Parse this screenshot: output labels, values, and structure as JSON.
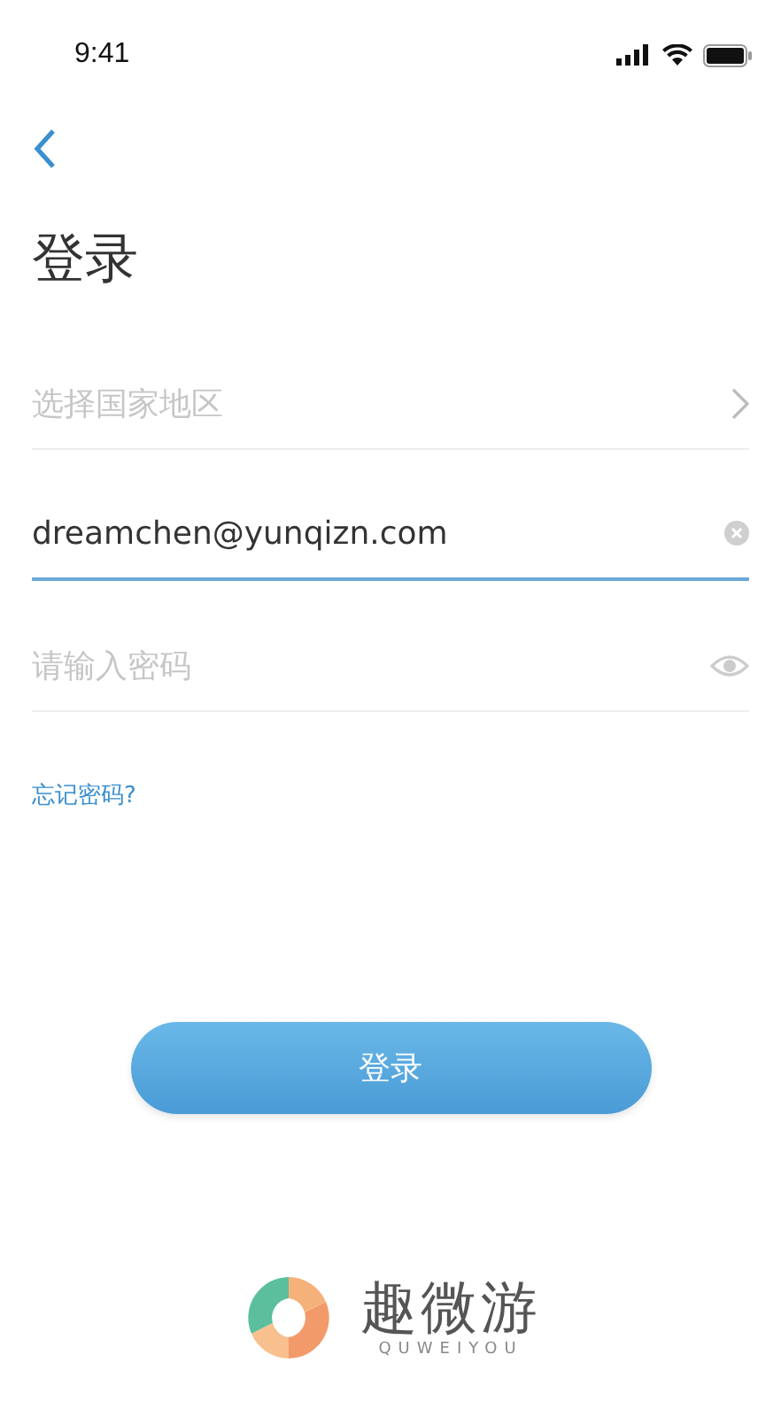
{
  "status_bar": {
    "time": "9:41"
  },
  "title": "登录",
  "fields": [
    {
      "kind": "select",
      "placeholder": "选择国家地区",
      "focused": false
    },
    {
      "kind": "text",
      "value": "dreamchen@yunqizn.com",
      "focused": true
    },
    {
      "kind": "password",
      "placeholder": "请输入密码",
      "focused": false
    }
  ],
  "forgot_link": "忘记密码?",
  "login_button": "登录",
  "brand": {
    "name": "趣微游",
    "tagline": "QUWEIYOU"
  }
}
